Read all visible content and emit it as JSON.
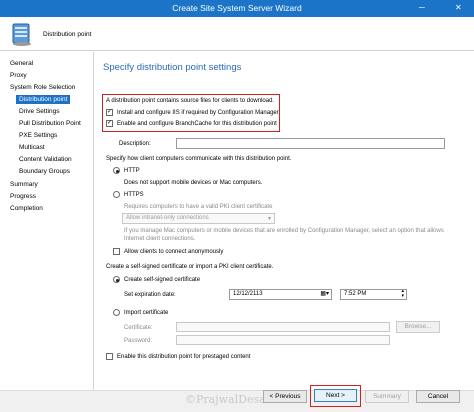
{
  "window": {
    "title": "Create Site System Server Wizard",
    "minimize": "─",
    "close": "✕"
  },
  "header": {
    "label": "Distribution point"
  },
  "nav": [
    {
      "label": "General"
    },
    {
      "label": "Proxy"
    },
    {
      "label": "System Role Selection"
    },
    {
      "label": "Distribution point"
    },
    {
      "label": "Drive Settings"
    },
    {
      "label": "Pull Distribution Point"
    },
    {
      "label": "PXE Settings"
    },
    {
      "label": "Multicast"
    },
    {
      "label": "Content Validation"
    },
    {
      "label": "Boundary Groups"
    },
    {
      "label": "Summary"
    },
    {
      "label": "Progress"
    },
    {
      "label": "Completion"
    }
  ],
  "page": {
    "title": "Specify distribution point settings",
    "intro": "A distribution point contains source files for clients to download.",
    "install_iis": "Install and configure IIS if required by Configuration Manager",
    "branchcache": "Enable and configure BranchCache for this distribution point",
    "description_label": "Description:",
    "description_value": "",
    "comm_label": "Specify how client computers communicate with this distribution point.",
    "http_label": "HTTP",
    "http_note": "Does not support mobile devices or Mac computers.",
    "https_label": "HTTPS",
    "pki_note": "Requires computers to have a valid PKI client certificate",
    "intranet_select": "Allow intranet-only connections",
    "mac_note_1": "If you manage Mac computers or mobile devices that are enrolled by Configuration Manager, select an option that allows",
    "mac_note_2": "Internet client connections.",
    "anon_label": "Allow clients to connect anonymously",
    "cert_section": "Create a self-signed certificate or import a PKI client certificate.",
    "self_signed_label": "Create self-signed certificate",
    "expiration_label": "Set expiration date:",
    "expiration_date": "12/12/2113",
    "expiration_time": "7:52 PM",
    "import_label": "Import certificate",
    "certificate_label": "Certificate:",
    "password_label": "Password:",
    "browse_label": "Browse...",
    "prestaged_label": "Enable this distribution point for prestaged content"
  },
  "footer": {
    "previous": "< Previous",
    "next": "Next >",
    "summary": "Summary",
    "cancel": "Cancel",
    "watermark": "©PrajwalDesai.com"
  },
  "colors": {
    "titlebar": "#1b74c8",
    "accent": "#2a6bb8",
    "highlight": "#d42020",
    "nav_selected": "#1e72c6"
  }
}
